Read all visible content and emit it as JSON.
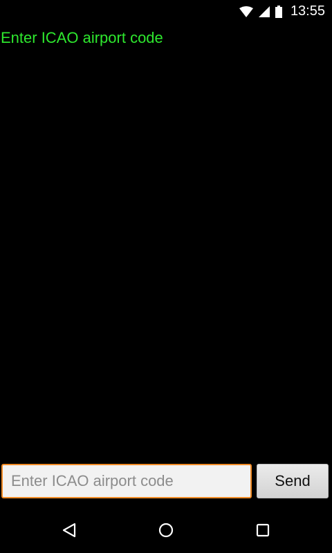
{
  "status_bar": {
    "time": "13:55",
    "icons": [
      "wifi-icon",
      "cell-signal-icon",
      "battery-icon"
    ]
  },
  "main": {
    "prompt": "Enter ICAO airport code"
  },
  "input_row": {
    "input_value": "",
    "input_placeholder": "Enter ICAO airport code",
    "send_label": "Send"
  },
  "nav_bar": {
    "icons": [
      "back-icon",
      "home-icon",
      "recents-icon"
    ]
  },
  "colors": {
    "background": "#000000",
    "prompt_text": "#2ee82e",
    "input_focus_border": "#f08a24",
    "input_background": "#f2f2f2",
    "button_background": "#dcdcdc",
    "system_icons": "#ffffff"
  }
}
